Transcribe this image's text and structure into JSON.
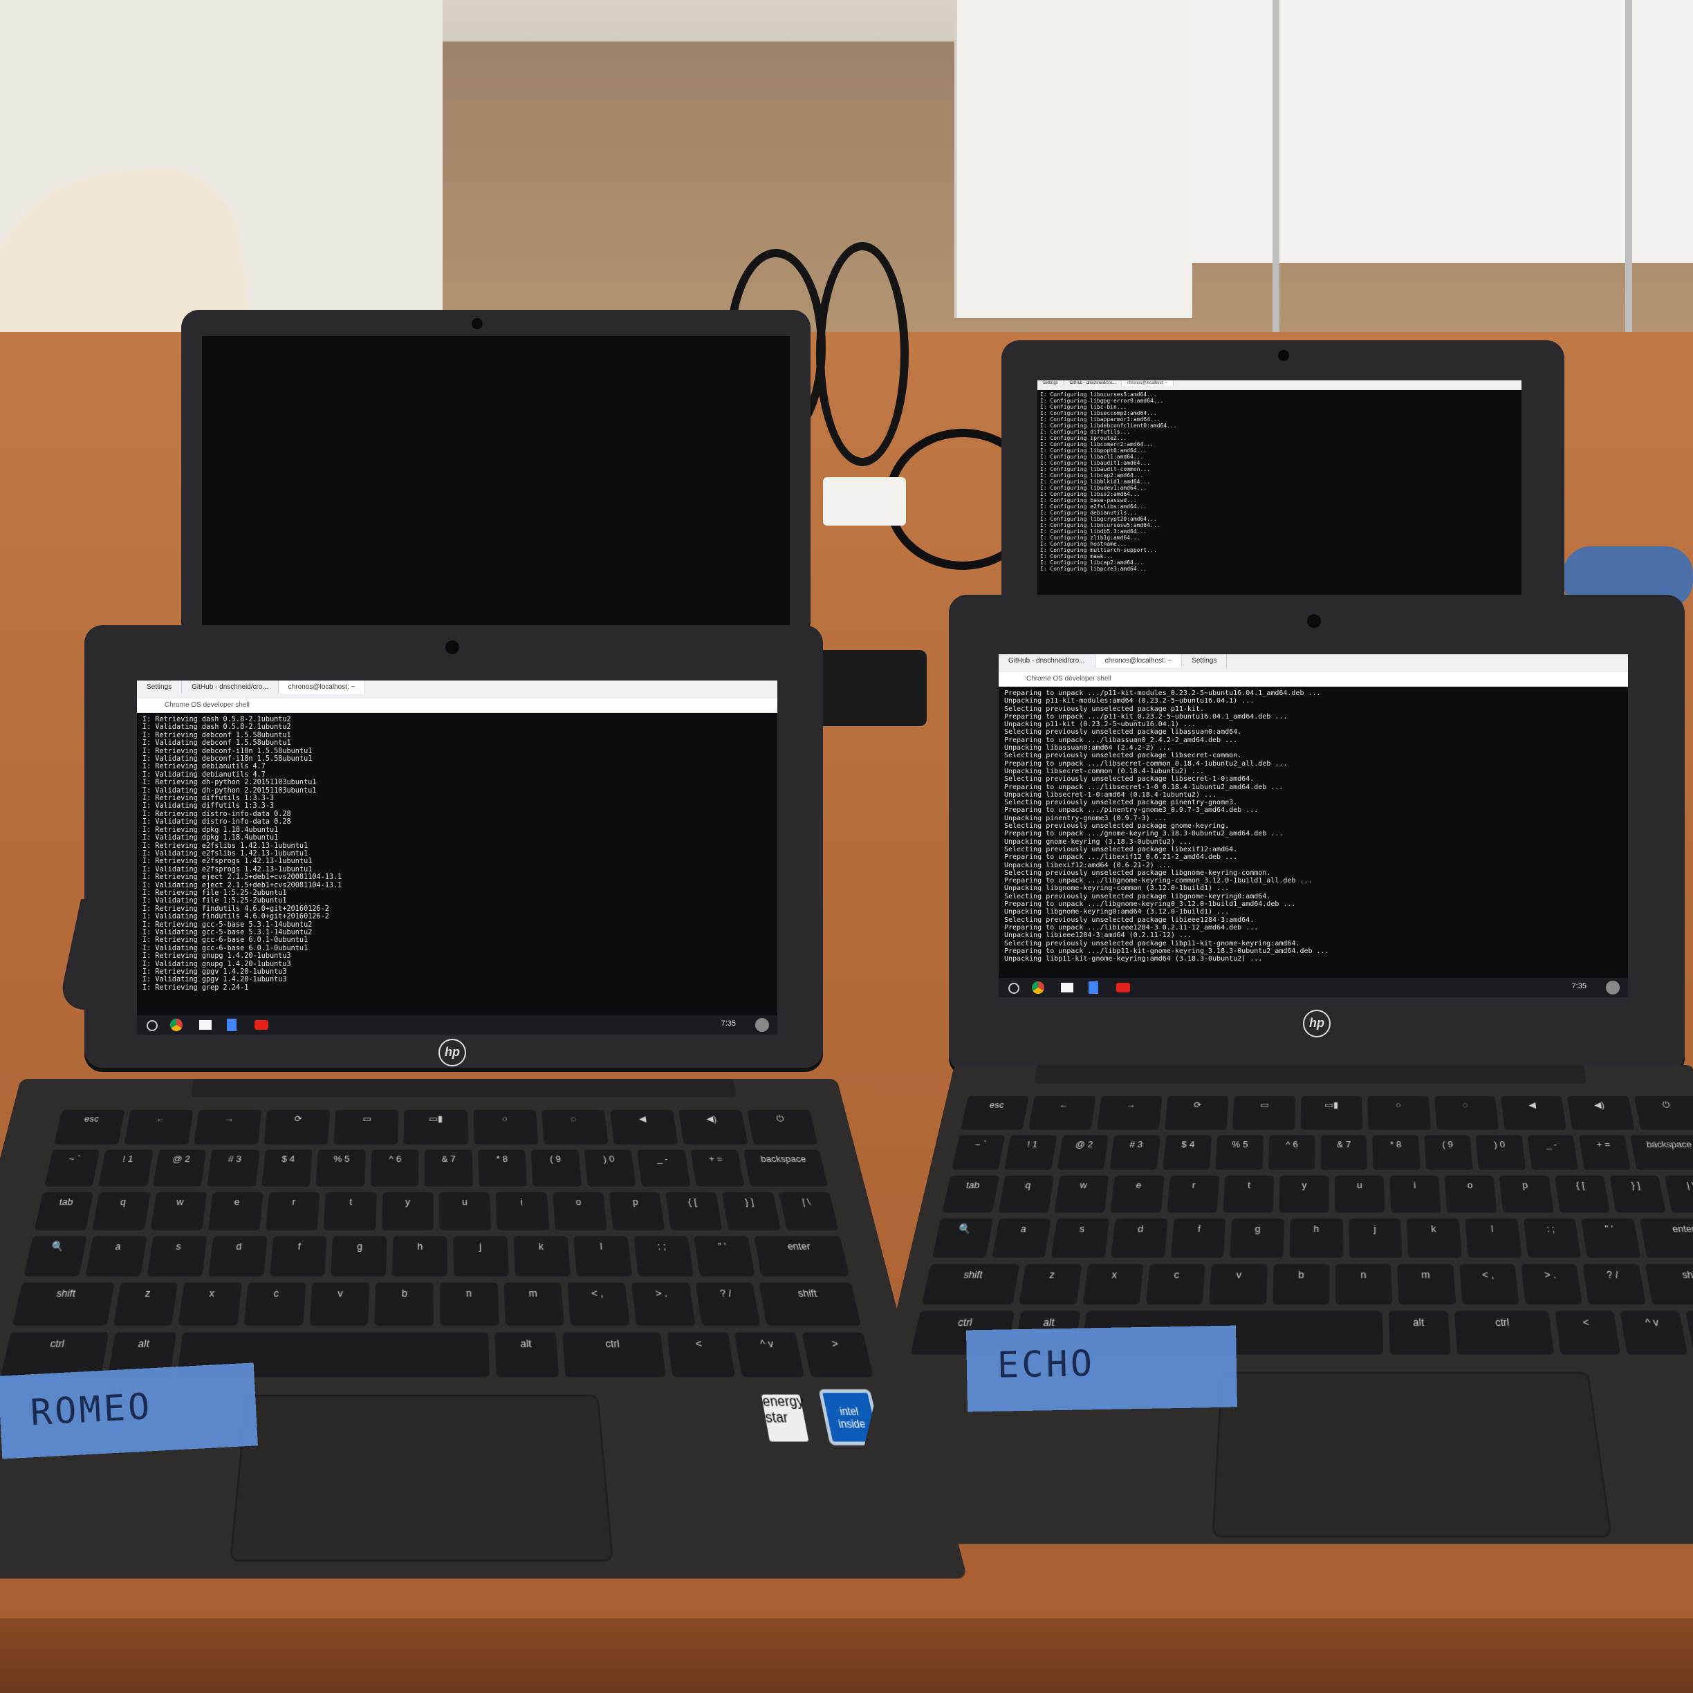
{
  "scene": {
    "description_free": true
  },
  "laptops": {
    "romeo": {
      "label": "ROMEO",
      "brand": "hp",
      "tabs": [
        "Settings",
        "GitHub - dnschneid/cro...",
        "chronos@localhost: ~"
      ],
      "url": "Chrome OS developer shell",
      "time": "7:35",
      "terminal": [
        "I: Retrieving dash 0.5.8-2.1ubuntu2",
        "I: Validating dash 0.5.8-2.1ubuntu2",
        "I: Retrieving debconf 1.5.58ubuntu1",
        "I: Validating debconf 1.5.58ubuntu1",
        "I: Retrieving debconf-i18n 1.5.58ubuntu1",
        "I: Validating debconf-i18n 1.5.58ubuntu1",
        "I: Retrieving debianutils 4.7",
        "I: Validating debianutils 4.7",
        "I: Retrieving dh-python 2.20151103ubuntu1",
        "I: Validating dh-python 2.20151103ubuntu1",
        "I: Retrieving diffutils 1:3.3-3",
        "I: Validating diffutils 1:3.3-3",
        "I: Retrieving distro-info-data 0.28",
        "I: Validating distro-info-data 0.28",
        "I: Retrieving dpkg 1.18.4ubuntu1",
        "I: Validating dpkg 1.18.4ubuntu1",
        "I: Retrieving e2fslibs 1.42.13-1ubuntu1",
        "I: Validating e2fslibs 1.42.13-1ubuntu1",
        "I: Retrieving e2fsprogs 1.42.13-1ubuntu1",
        "I: Validating e2fsprogs 1.42.13-1ubuntu1",
        "I: Retrieving eject 2.1.5+deb1+cvs20081104-13.1",
        "I: Validating eject 2.1.5+deb1+cvs20081104-13.1",
        "I: Retrieving file 1:5.25-2ubuntu1",
        "I: Validating file 1:5.25-2ubuntu1",
        "I: Retrieving findutils 4.6.0+git+20160126-2",
        "I: Validating findutils 4.6.0+git+20160126-2",
        "I: Retrieving gcc-5-base 5.3.1-14ubuntu2",
        "I: Validating gcc-5-base 5.3.1-14ubuntu2",
        "I: Retrieving gcc-6-base 6.0.1-0ubuntu1",
        "I: Validating gcc-6-base 6.0.1-0ubuntu1",
        "I: Retrieving gnupg 1.4.20-1ubuntu3",
        "I: Validating gnupg 1.4.20-1ubuntu3",
        "I: Retrieving gpgv 1.4.20-1ubuntu3",
        "I: Validating gpgv 1.4.20-1ubuntu3",
        "I: Retrieving grep 2.24-1"
      ]
    },
    "echo": {
      "label": "ECHO",
      "brand": "hp",
      "tabs": [
        "GitHub - dnschneid/cro...",
        "chronos@localhost: ~",
        "Settings"
      ],
      "url": "Chrome OS developer shell",
      "time": "7:35",
      "terminal": [
        "Preparing to unpack .../p11-kit-modules_0.23.2-5~ubuntu16.04.1_amd64.deb ...",
        "Unpacking p11-kit-modules:amd64 (0.23.2-5~ubuntu16.04.1) ...",
        "Selecting previously unselected package p11-kit.",
        "Preparing to unpack .../p11-kit_0.23.2-5~ubuntu16.04.1_amd64.deb ...",
        "Unpacking p11-kit (0.23.2-5~ubuntu16.04.1) ...",
        "Selecting previously unselected package libassuan0:amd64.",
        "Preparing to unpack .../libassuan0_2.4.2-2_amd64.deb ...",
        "Unpacking libassuan0:amd64 (2.4.2-2) ...",
        "Selecting previously unselected package libsecret-common.",
        "Preparing to unpack .../libsecret-common_0.18.4-1ubuntu2_all.deb ...",
        "Unpacking libsecret-common (0.18.4-1ubuntu2) ...",
        "Selecting previously unselected package libsecret-1-0:amd64.",
        "Preparing to unpack .../libsecret-1-0_0.18.4-1ubuntu2_amd64.deb ...",
        "Unpacking libsecret-1-0:amd64 (0.18.4-1ubuntu2) ...",
        "Selecting previously unselected package pinentry-gnome3.",
        "Preparing to unpack .../pinentry-gnome3_0.9.7-3_amd64.deb ...",
        "Unpacking pinentry-gnome3 (0.9.7-3) ...",
        "Selecting previously unselected package gnome-keyring.",
        "Preparing to unpack .../gnome-keyring_3.18.3-0ubuntu2_amd64.deb ...",
        "Unpacking gnome-keyring (3.18.3-0ubuntu2) ...",
        "Selecting previously unselected package libexif12:amd64.",
        "Preparing to unpack .../libexif12_0.6.21-2_amd64.deb ...",
        "Unpacking libexif12:amd64 (0.6.21-2) ...",
        "Selecting previously unselected package libgnome-keyring-common.",
        "Preparing to unpack .../libgnome-keyring-common_3.12.0-1build1_all.deb ...",
        "Unpacking libgnome-keyring-common (3.12.0-1build1) ...",
        "Selecting previously unselected package libgnome-keyring0:amd64.",
        "Preparing to unpack .../libgnome-keyring0_3.12.0-1build1_amd64.deb ...",
        "Unpacking libgnome-keyring0:amd64 (3.12.0-1build1) ...",
        "Selecting previously unselected package libieee1284-3:amd64.",
        "Preparing to unpack .../libieee1284-3_0.2.11-12_amd64.deb ...",
        "Unpacking libieee1284-3:amd64 (0.2.11-12) ...",
        "Selecting previously unselected package libp11-kit-gnome-keyring:amd64.",
        "Preparing to unpack .../libp11-kit-gnome-keyring_3.18.3-0ubuntu2_amd64.deb ...",
        "Unpacking libp11-kit-gnome-keyring:amd64 (3.18.3-0ubuntu2) ..."
      ]
    },
    "back_right": {
      "tabs": [
        "Settings",
        "GitHub - dnschneid/cro...",
        "chronos@localhost: ~"
      ],
      "terminal": [
        "I: Configuring libncurses5:amd64...",
        "I: Configuring libgpg-error0:amd64...",
        "I: Configuring libc-bin...",
        "I: Configuring libseccomp2:amd64...",
        "I: Configuring libapparmor1:amd64...",
        "I: Configuring libdebconfclient0:amd64...",
        "I: Configuring diffutils...",
        "I: Configuring iproute2...",
        "I: Configuring libcomerr2:amd64...",
        "I: Configuring libpopt0:amd64...",
        "I: Configuring libacl1:amd64...",
        "I: Configuring libaudit1:amd64...",
        "I: Configuring libaudit-common...",
        "I: Configuring libcap2:amd64...",
        "I: Configuring libblkid1:amd64...",
        "I: Configuring libudev1:amd64...",
        "I: Configuring libss2:amd64...",
        "I: Configuring base-passwd...",
        "I: Configuring e2fslibs:amd64...",
        "I: Configuring debianutils...",
        "I: Configuring libgcrypt20:amd64...",
        "I: Configuring libncursesw5:amd64...",
        "I: Configuring libdb5.3:amd64...",
        "I: Configuring zlib1g:amd64...",
        "I: Configuring hostname...",
        "I: Configuring multiarch-support...",
        "I: Configuring mawk...",
        "I: Configuring libcap2:amd64...",
        "I: Configuring libpcre3:amd64..."
      ]
    }
  },
  "keyboard": {
    "row0": [
      "esc",
      "←",
      "→",
      "⟳",
      "▭",
      "▭▮",
      "○",
      "◌",
      "◀",
      "◀)",
      "⏻"
    ],
    "row1": [
      "~ `",
      "! 1",
      "@ 2",
      "# 3",
      "$ 4",
      "% 5",
      "^ 6",
      "& 7",
      "* 8",
      "( 9",
      ") 0",
      "_ -",
      "+ =",
      "backspace"
    ],
    "row2": [
      "tab",
      "q",
      "w",
      "e",
      "r",
      "t",
      "y",
      "u",
      "i",
      "o",
      "p",
      "{ [",
      "} ]",
      "| \\"
    ],
    "row3": [
      "🔍",
      "a",
      "s",
      "d",
      "f",
      "g",
      "h",
      "j",
      "k",
      "l",
      ": ;",
      "\" '",
      "enter"
    ],
    "row4": [
      "shift",
      "z",
      "x",
      "c",
      "v",
      "b",
      "n",
      "m",
      "< ,",
      "> .",
      "? /",
      "shift"
    ],
    "row5": [
      "ctrl",
      "alt",
      "",
      "alt",
      "ctrl",
      "<",
      "^ v",
      ">"
    ]
  },
  "stickers": {
    "intel": "intel inside",
    "energy": "energy star"
  },
  "colors": {
    "tape": "#5f8fd8",
    "table": "#b56c3a",
    "laptop_body": "#2f2c2c"
  }
}
